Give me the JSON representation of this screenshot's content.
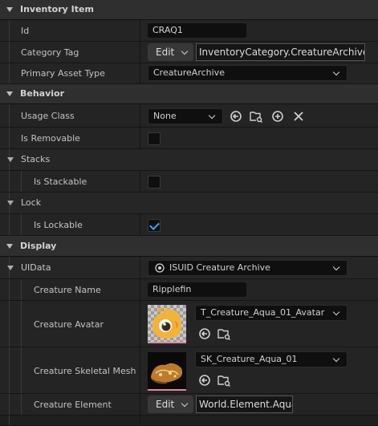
{
  "sections": {
    "inventory_item": "Inventory Item",
    "behavior": "Behavior",
    "display": "Display"
  },
  "groups": {
    "stacks": "Stacks",
    "lock": "Lock",
    "uidata": "UIData"
  },
  "fields": {
    "id": {
      "label": "Id",
      "value": "CRAQ1"
    },
    "category_tag": {
      "label": "Category Tag",
      "button": "Edit",
      "value": "InventoryCategory.CreatureArchive"
    },
    "primary_asset_type": {
      "label": "Primary Asset Type",
      "value": "CreatureArchive"
    },
    "usage_class": {
      "label": "Usage Class",
      "value": "None"
    },
    "is_removable": {
      "label": "Is Removable",
      "checked": false
    },
    "is_stackable": {
      "label": "Is Stackable",
      "checked": false
    },
    "is_lockable": {
      "label": "Is Lockable",
      "checked": true
    },
    "uidata": {
      "value": "ISUID Creature Archive"
    },
    "creature_name": {
      "label": "Creature Name",
      "value": "Ripplefin"
    },
    "creature_avatar": {
      "label": "Creature Avatar",
      "value": "T_Creature_Aqua_01_Avatar"
    },
    "creature_skeletal_mesh": {
      "label": "Creature Skeletal Mesh",
      "value": "SK_Creature_Aqua_01"
    },
    "creature_element": {
      "label": "Creature Element",
      "button": "Edit",
      "value": "World.Element.Aqua"
    }
  },
  "colors": {
    "accent": "#3aa3ff",
    "section_bg": "#2f2f2f",
    "row_bg": "#242424",
    "thumb_underline": "#e08aa8"
  },
  "icons": [
    "browse-arrow-icon",
    "folder-search-icon",
    "add-circle-icon",
    "clear-x-icon",
    "uid-circle-icon",
    "chevron-down-icon"
  ]
}
